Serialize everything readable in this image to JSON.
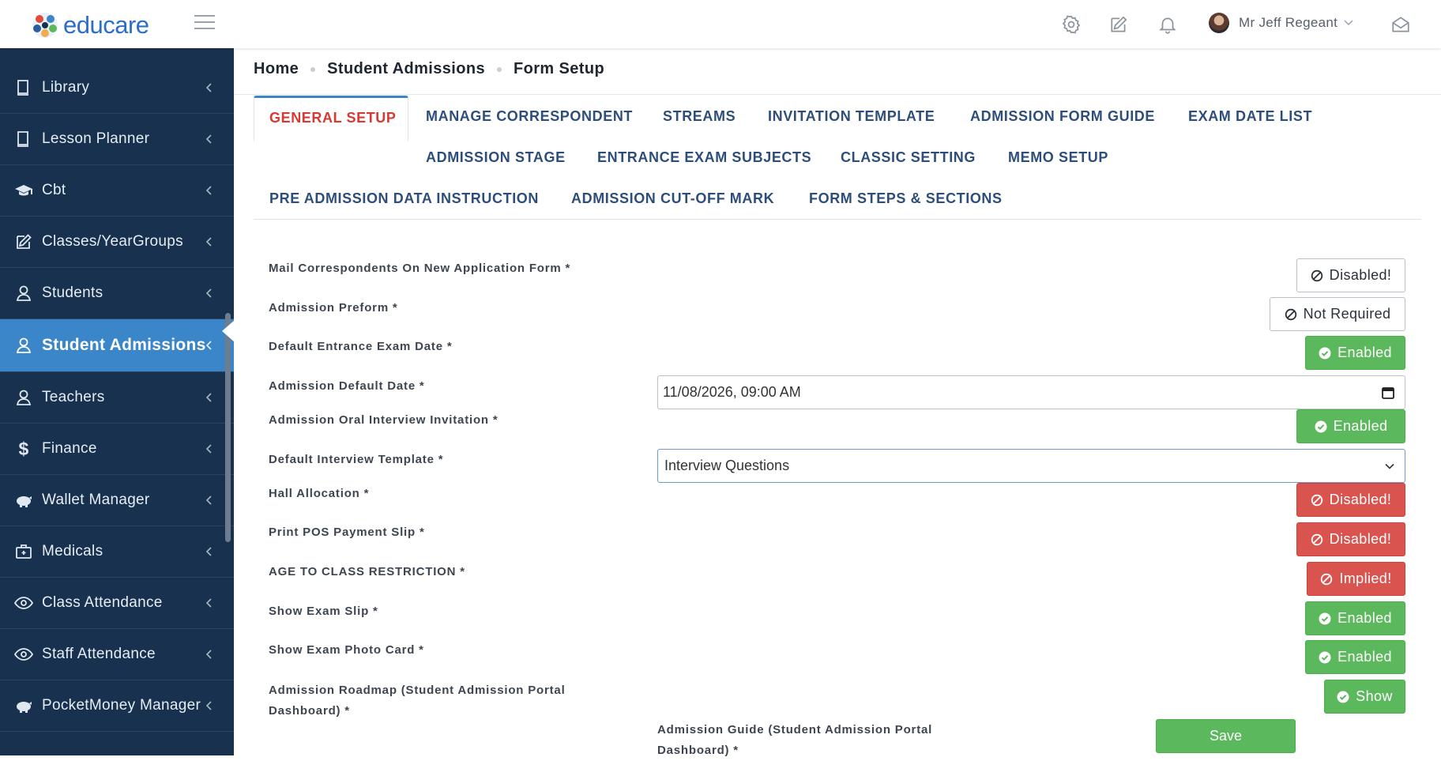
{
  "brand": {
    "name": "educare"
  },
  "user": {
    "name": "Mr Jeff Regeant"
  },
  "header_icons": [
    "gear-icon",
    "edit-icon",
    "bell-icon",
    "envelope-open-icon"
  ],
  "sidebar": {
    "items": [
      {
        "label": "Library",
        "icon": "book-icon"
      },
      {
        "label": "Lesson Planner",
        "icon": "book-icon"
      },
      {
        "label": "Cbt",
        "icon": "graduation-cap-icon"
      },
      {
        "label": "Classes/YearGroups",
        "icon": "edit-icon"
      },
      {
        "label": "Students",
        "icon": "user-icon"
      },
      {
        "label": "Student Admissions",
        "icon": "user-icon",
        "active": true
      },
      {
        "label": "Teachers",
        "icon": "user-icon"
      },
      {
        "label": "Finance",
        "icon": "dollar-icon"
      },
      {
        "label": "Wallet Manager",
        "icon": "piggy-bank-icon"
      },
      {
        "label": "Medicals",
        "icon": "medkit-icon"
      },
      {
        "label": "Class Attendance",
        "icon": "eye-icon"
      },
      {
        "label": "Staff Attendance",
        "icon": "eye-icon"
      },
      {
        "label": "PocketMoney Manager",
        "icon": "piggy-bank-icon"
      }
    ]
  },
  "breadcrumb": [
    "Home",
    "Student Admissions",
    "Form Setup"
  ],
  "tabs": [
    "GENERAL SETUP",
    "MANAGE CORRESPONDENT",
    "STREAMS",
    "INVITATION TEMPLATE",
    "ADMISSION FORM GUIDE",
    "EXAM DATE LIST",
    "ADMISSION STAGE",
    "ENTRANCE EXAM SUBJECTS",
    "CLASSIC SETTING",
    "MEMO SETUP",
    "PRE ADMISSION DATA INSTRUCTION",
    "ADMISSION CUT-OFF MARK",
    "FORM STEPS & SECTIONS"
  ],
  "active_tab": "GENERAL SETUP",
  "form": {
    "rows": [
      {
        "label": "Mail Correspondents On New Application Form *",
        "button": "Disabled!",
        "style": "outline"
      },
      {
        "label": "Admission Preform *",
        "button": "Not Required",
        "style": "outline"
      },
      {
        "label": "Default Entrance Exam Date *",
        "button": "Enabled",
        "style": "green"
      },
      {
        "label": "Admission Default Date *"
      },
      {
        "label": "Admission Oral Interview Invitation *",
        "button": "Enabled",
        "style": "green"
      },
      {
        "label": "Default Interview Template *"
      },
      {
        "label": "Hall Allocation *",
        "button": "Disabled!",
        "style": "red"
      },
      {
        "label": "Print POS Payment Slip *",
        "button": "Disabled!",
        "style": "red"
      },
      {
        "label": "AGE TO CLASS RESTRICTION *",
        "button": "Implied!",
        "style": "red"
      },
      {
        "label": "Show Exam Slip *",
        "button": "Enabled",
        "style": "green"
      },
      {
        "label": "Show Exam Photo Card *",
        "button": "Enabled",
        "style": "green"
      },
      {
        "label_line1": "Admission Roadmap (Student Admission Portal",
        "label_line2": "Dashboard) *",
        "button": "Show",
        "style": "green"
      }
    ],
    "admission_default_date": "11/08/2026, 09:00  AM",
    "interview_template_selected": "Interview Questions",
    "guide_label_line1": "Admission Guide (Student Admission Portal",
    "guide_label_line2": "Dashboard) *",
    "save_label": "Save"
  },
  "colors": {
    "sidebar_bg": "#17314f",
    "sidebar_active": "#3a86c8",
    "enabled": "#5cb85c",
    "disabled": "#d9534f",
    "tab_active": "#d63a33",
    "tab_text": "#2d4e7b"
  }
}
